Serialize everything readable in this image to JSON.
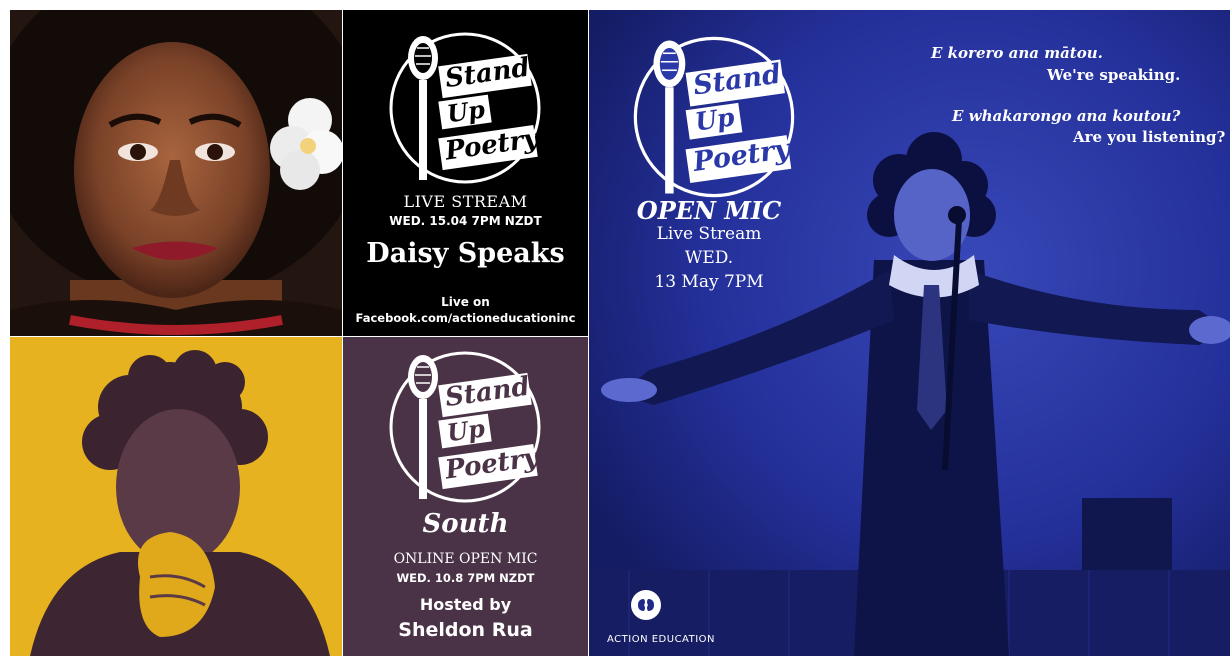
{
  "colors": {
    "black_panel": "#000000",
    "purple_panel": "#4a3346",
    "blue_panel": "#1f2a8a",
    "yellow": "#e6b21f",
    "white": "#ffffff"
  },
  "logo": {
    "line1": "Stand",
    "line2": "Up",
    "line3": "Poetry"
  },
  "panel_daisy": {
    "event": "LIVE STREAM",
    "date": "WED. 15.04 7PM NZDT",
    "performer": "Daisy Speaks",
    "live_on": "Live on",
    "url": "Facebook.com/actioneducationinc"
  },
  "panel_south": {
    "subtitle": "South",
    "event": "ONLINE OPEN MIC",
    "date": "WED. 10.8 7PM NZDT",
    "hosted_by": "Hosted by",
    "host": "Sheldon Rua"
  },
  "panel_open_mic": {
    "title": "OPEN MIC",
    "line1": "Live Stream",
    "line2": "WED.",
    "line3": "13 May 7PM",
    "quote1_maori": "E korero ana mātou.",
    "quote1_english": "We're speaking.",
    "quote2_maori": "E whakarongo ana koutou?",
    "quote2_english": "Are you listening?",
    "brand": "ACTION EDUCATION"
  },
  "icons": {
    "microphone": "microphone-icon",
    "action_education_logo": "action-education-logo-icon",
    "flower": "plumeria-flower-icon"
  }
}
